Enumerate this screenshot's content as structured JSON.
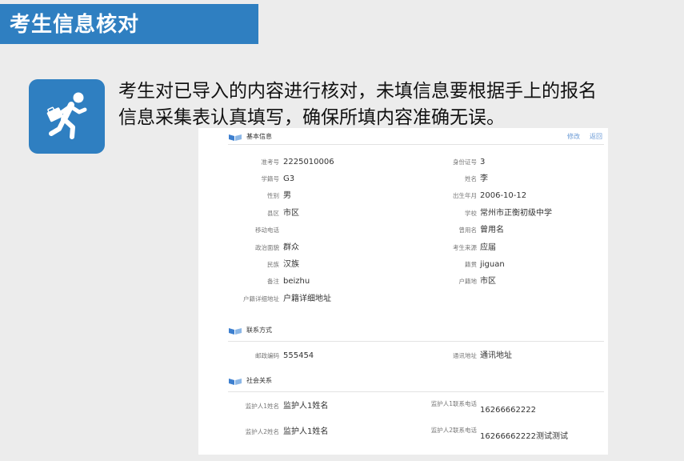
{
  "header": {
    "title": "考生信息核对"
  },
  "icon": {
    "name": "running-person-icon",
    "bg_color": "#2f7fc1"
  },
  "instruction": {
    "line1": "考生对已导入的内容进行核对，未填信息要根据手上的报名",
    "line2": "信息采集表认真填写，确保所填内容准确无误。"
  },
  "panel": {
    "links": {
      "edit": "修改",
      "back": "返回"
    },
    "basic": {
      "title": "基本信息",
      "fields": [
        {
          "label": "准考号",
          "value": "2225010006"
        },
        {
          "label": "身份证号",
          "value": "3"
        },
        {
          "label": "学籍号",
          "value": "G3"
        },
        {
          "label": "姓名",
          "value": "李"
        },
        {
          "label": "性别",
          "value": "男"
        },
        {
          "label": "出生年月",
          "value": "2006-10-12"
        },
        {
          "label": "县区",
          "value": "市区"
        },
        {
          "label": "学校",
          "value": "常州市正衡初级中学"
        },
        {
          "label": "移动电话",
          "value": ""
        },
        {
          "label": "曾用名",
          "value": "曾用名"
        },
        {
          "label": "政治面貌",
          "value": "群众"
        },
        {
          "label": "考生来源",
          "value": "应届"
        },
        {
          "label": "民族",
          "value": "汉族"
        },
        {
          "label": "籍贯",
          "value": "jiguan"
        },
        {
          "label": "备注",
          "value": "beizhu"
        },
        {
          "label": "户籍地",
          "value": "市区"
        },
        {
          "label": "户籍详细地址",
          "value": "户籍详细地址"
        }
      ]
    },
    "contact": {
      "title": "联系方式",
      "fields": [
        {
          "label": "邮政编码",
          "value": "555454"
        },
        {
          "label": "通讯地址",
          "value": "通讯地址"
        }
      ]
    },
    "social": {
      "title": "社会关系",
      "fields": [
        {
          "label": "监护人1姓名",
          "value": "监护人1姓名"
        },
        {
          "label": "监护人1联系电话",
          "value": "16266662222"
        },
        {
          "label": "监护人2姓名",
          "value": "监护人1姓名"
        },
        {
          "label": "监护人2联系电话",
          "value": "16266662222测试测试"
        }
      ]
    }
  }
}
